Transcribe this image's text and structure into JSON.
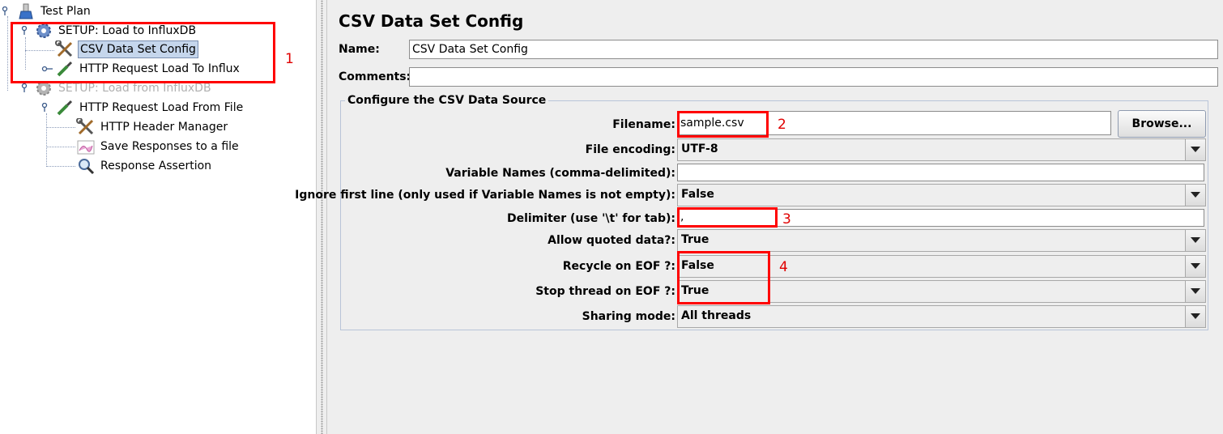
{
  "tree": {
    "items": [
      {
        "label": "Test Plan",
        "icon": "test-plan-icon"
      },
      {
        "label": "SETUP: Load to InfluxDB",
        "icon": "gear-icon"
      },
      {
        "label": "CSV Data Set Config",
        "icon": "wrench-screwdriver-icon"
      },
      {
        "label": "HTTP Request Load To Influx",
        "icon": "pipette-icon"
      },
      {
        "label": "SETUP: Load from InfluxDB",
        "icon": "gear-icon"
      },
      {
        "label": "HTTP Request Load From File",
        "icon": "pipette-icon"
      },
      {
        "label": "HTTP Header Manager",
        "icon": "wrench-screwdriver-icon"
      },
      {
        "label": "Save Responses to a file",
        "icon": "chart-icon"
      },
      {
        "label": "Response Assertion",
        "icon": "magnifier-icon"
      }
    ]
  },
  "annotations": {
    "a1": "1",
    "a2": "2",
    "a3": "3",
    "a4": "4"
  },
  "panel": {
    "title": "CSV Data Set Config",
    "name_label": "Name:",
    "name_value": "CSV Data Set Config",
    "comments_label": "Comments:",
    "comments_value": "",
    "group_title": "Configure the CSV Data Source",
    "filename_label": "Filename:",
    "filename_value": "sample.csv",
    "browse_label": "Browse...",
    "encoding_label": "File encoding:",
    "encoding_value": "UTF-8",
    "varnames_label": "Variable Names (comma-delimited):",
    "varnames_value": "",
    "ignore_label": "Ignore first line (only used if Variable Names is not empty):",
    "ignore_value": "False",
    "delimiter_label": "Delimiter (use '\\t' for tab):",
    "delimiter_value": ",",
    "quoted_label": "Allow quoted data?:",
    "quoted_value": "True",
    "recycle_label": "Recycle on EOF ?:",
    "recycle_value": "False",
    "stop_label": "Stop thread on EOF ?:",
    "stop_value": "True",
    "sharing_label": "Sharing mode:",
    "sharing_value": "All threads"
  }
}
